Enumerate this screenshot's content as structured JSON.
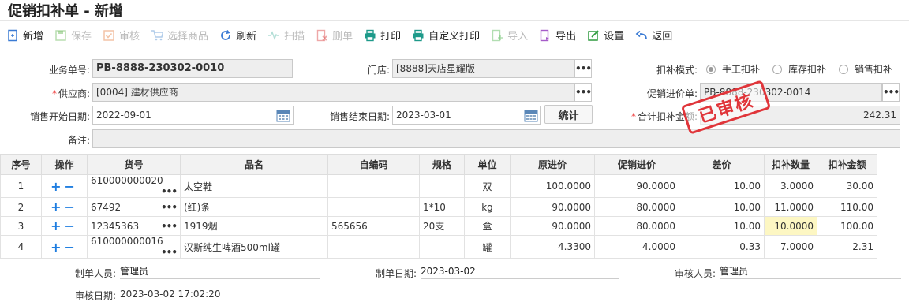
{
  "title": "促销扣补单 - 新增",
  "toolbar": [
    {
      "label": "新增",
      "icon": "new-doc-icon",
      "enabled": true,
      "color": "#3b7bd4"
    },
    {
      "label": "保存",
      "icon": "save-icon",
      "enabled": false,
      "color": "#7cbf6a"
    },
    {
      "label": "审核",
      "icon": "approve-icon",
      "enabled": false,
      "color": "#e9915a"
    },
    {
      "label": "选择商品",
      "icon": "cart-icon",
      "enabled": false,
      "color": "#6a9fd8"
    },
    {
      "label": "刷新",
      "icon": "refresh-icon",
      "enabled": true,
      "color": "#3b7bd4"
    },
    {
      "label": "扫描",
      "icon": "scan-icon",
      "enabled": false,
      "color": "#6fc2b3"
    },
    {
      "label": "删单",
      "icon": "delete-doc-icon",
      "enabled": false,
      "color": "#e05a5a"
    },
    {
      "label": "打印",
      "icon": "print-icon",
      "enabled": true,
      "color": "#1e9a8a"
    },
    {
      "label": "自定义打印",
      "icon": "custom-print-icon",
      "enabled": true,
      "color": "#1e9a8a"
    },
    {
      "label": "导入",
      "icon": "import-icon",
      "enabled": false,
      "color": "#6fc26f"
    },
    {
      "label": "导出",
      "icon": "export-icon",
      "enabled": true,
      "color": "#a65cc9"
    },
    {
      "label": "设置",
      "icon": "settings-icon",
      "enabled": true,
      "color": "#2e9a3e"
    },
    {
      "label": "返回",
      "icon": "back-icon",
      "enabled": true,
      "color": "#3b7bd4"
    }
  ],
  "form": {
    "doc_no_label": "业务单号:",
    "doc_no": "PB-8888-230302-0010",
    "store_label": "门店:",
    "store": "[8888]天店星耀版",
    "mode_label": "扣补模式:",
    "mode_options": [
      "手工扣补",
      "库存扣补",
      "销售扣补"
    ],
    "mode_selected": "手工扣补",
    "supplier_label": "供应商:",
    "supplier": "[0004]     建材供应商",
    "promo_price_label": "促销进价单:",
    "promo_price": "PB-8888-230302-0014",
    "start_label": "销售开始日期:",
    "start_date": "2022-09-01",
    "end_label": "销售结束日期:",
    "end_date": "2023-03-01",
    "stat_button": "统计",
    "total_label": "合计扣补金额:",
    "total": "242.31",
    "remark_label": "备注:",
    "remark": "",
    "stamp": "已审核"
  },
  "table": {
    "headers": [
      "序号",
      "操作",
      "货号",
      "品名",
      "自编码",
      "规格",
      "单位",
      "原进价",
      "促销进价",
      "差价",
      "扣补数量",
      "扣补金额"
    ],
    "rows": [
      {
        "no": "1",
        "code": "610000000020",
        "name": "太空鞋",
        "selfcode": "",
        "spec": "",
        "unit": "双",
        "orig": "100.0000",
        "promo": "90.0000",
        "diff": "10.00",
        "qty": "3.0000",
        "amount": "30.00"
      },
      {
        "no": "2",
        "code": "67492",
        "name": "(红)条",
        "selfcode": "",
        "spec": "1*10",
        "unit": "kg",
        "orig": "90.0000",
        "promo": "80.0000",
        "diff": "10.00",
        "qty": "11.0000",
        "amount": "110.00"
      },
      {
        "no": "3",
        "code": "12345363",
        "name": "1919烟",
        "selfcode": "565656",
        "spec": "20支",
        "unit": "盒",
        "orig": "90.0000",
        "promo": "80.0000",
        "diff": "10.00",
        "qty": "10.0000",
        "amount": "100.00"
      },
      {
        "no": "4",
        "code": "610000000016",
        "name": "汉斯纯生啤酒500ml罐",
        "selfcode": "",
        "spec": "",
        "unit": "罐",
        "orig": "4.3300",
        "promo": "4.0000",
        "diff": "0.33",
        "qty": "7.0000",
        "amount": "2.31"
      }
    ]
  },
  "footer": {
    "maker_label": "制单人员:",
    "maker": "管理员",
    "make_date_label": "制单日期:",
    "make_date": "2023-03-02",
    "auditor_label": "审核人员:",
    "auditor": "管理员",
    "audit_date_label": "审核日期:",
    "audit_date": "2023-03-02 17:02:20"
  }
}
